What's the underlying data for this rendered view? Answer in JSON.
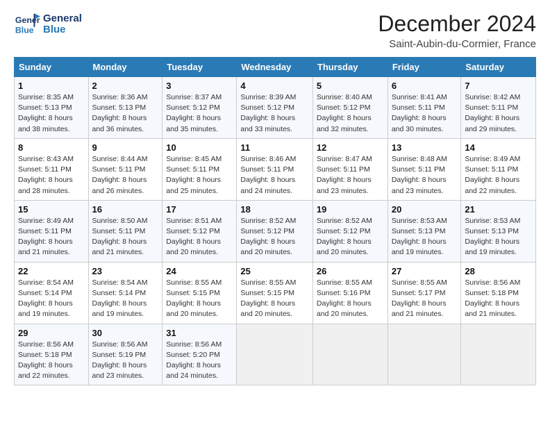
{
  "header": {
    "logo_general": "General",
    "logo_blue": "Blue",
    "month_title": "December 2024",
    "location": "Saint-Aubin-du-Cormier, France"
  },
  "days_of_week": [
    "Sunday",
    "Monday",
    "Tuesday",
    "Wednesday",
    "Thursday",
    "Friday",
    "Saturday"
  ],
  "weeks": [
    [
      {
        "day": "1",
        "info": "Sunrise: 8:35 AM\nSunset: 5:13 PM\nDaylight: 8 hours\nand 38 minutes."
      },
      {
        "day": "2",
        "info": "Sunrise: 8:36 AM\nSunset: 5:13 PM\nDaylight: 8 hours\nand 36 minutes."
      },
      {
        "day": "3",
        "info": "Sunrise: 8:37 AM\nSunset: 5:12 PM\nDaylight: 8 hours\nand 35 minutes."
      },
      {
        "day": "4",
        "info": "Sunrise: 8:39 AM\nSunset: 5:12 PM\nDaylight: 8 hours\nand 33 minutes."
      },
      {
        "day": "5",
        "info": "Sunrise: 8:40 AM\nSunset: 5:12 PM\nDaylight: 8 hours\nand 32 minutes."
      },
      {
        "day": "6",
        "info": "Sunrise: 8:41 AM\nSunset: 5:11 PM\nDaylight: 8 hours\nand 30 minutes."
      },
      {
        "day": "7",
        "info": "Sunrise: 8:42 AM\nSunset: 5:11 PM\nDaylight: 8 hours\nand 29 minutes."
      }
    ],
    [
      {
        "day": "8",
        "info": "Sunrise: 8:43 AM\nSunset: 5:11 PM\nDaylight: 8 hours\nand 28 minutes."
      },
      {
        "day": "9",
        "info": "Sunrise: 8:44 AM\nSunset: 5:11 PM\nDaylight: 8 hours\nand 26 minutes."
      },
      {
        "day": "10",
        "info": "Sunrise: 8:45 AM\nSunset: 5:11 PM\nDaylight: 8 hours\nand 25 minutes."
      },
      {
        "day": "11",
        "info": "Sunrise: 8:46 AM\nSunset: 5:11 PM\nDaylight: 8 hours\nand 24 minutes."
      },
      {
        "day": "12",
        "info": "Sunrise: 8:47 AM\nSunset: 5:11 PM\nDaylight: 8 hours\nand 23 minutes."
      },
      {
        "day": "13",
        "info": "Sunrise: 8:48 AM\nSunset: 5:11 PM\nDaylight: 8 hours\nand 23 minutes."
      },
      {
        "day": "14",
        "info": "Sunrise: 8:49 AM\nSunset: 5:11 PM\nDaylight: 8 hours\nand 22 minutes."
      }
    ],
    [
      {
        "day": "15",
        "info": "Sunrise: 8:49 AM\nSunset: 5:11 PM\nDaylight: 8 hours\nand 21 minutes."
      },
      {
        "day": "16",
        "info": "Sunrise: 8:50 AM\nSunset: 5:11 PM\nDaylight: 8 hours\nand 21 minutes."
      },
      {
        "day": "17",
        "info": "Sunrise: 8:51 AM\nSunset: 5:12 PM\nDaylight: 8 hours\nand 20 minutes."
      },
      {
        "day": "18",
        "info": "Sunrise: 8:52 AM\nSunset: 5:12 PM\nDaylight: 8 hours\nand 20 minutes."
      },
      {
        "day": "19",
        "info": "Sunrise: 8:52 AM\nSunset: 5:12 PM\nDaylight: 8 hours\nand 20 minutes."
      },
      {
        "day": "20",
        "info": "Sunrise: 8:53 AM\nSunset: 5:13 PM\nDaylight: 8 hours\nand 19 minutes."
      },
      {
        "day": "21",
        "info": "Sunrise: 8:53 AM\nSunset: 5:13 PM\nDaylight: 8 hours\nand 19 minutes."
      }
    ],
    [
      {
        "day": "22",
        "info": "Sunrise: 8:54 AM\nSunset: 5:14 PM\nDaylight: 8 hours\nand 19 minutes."
      },
      {
        "day": "23",
        "info": "Sunrise: 8:54 AM\nSunset: 5:14 PM\nDaylight: 8 hours\nand 19 minutes."
      },
      {
        "day": "24",
        "info": "Sunrise: 8:55 AM\nSunset: 5:15 PM\nDaylight: 8 hours\nand 20 minutes."
      },
      {
        "day": "25",
        "info": "Sunrise: 8:55 AM\nSunset: 5:15 PM\nDaylight: 8 hours\nand 20 minutes."
      },
      {
        "day": "26",
        "info": "Sunrise: 8:55 AM\nSunset: 5:16 PM\nDaylight: 8 hours\nand 20 minutes."
      },
      {
        "day": "27",
        "info": "Sunrise: 8:55 AM\nSunset: 5:17 PM\nDaylight: 8 hours\nand 21 minutes."
      },
      {
        "day": "28",
        "info": "Sunrise: 8:56 AM\nSunset: 5:18 PM\nDaylight: 8 hours\nand 21 minutes."
      }
    ],
    [
      {
        "day": "29",
        "info": "Sunrise: 8:56 AM\nSunset: 5:18 PM\nDaylight: 8 hours\nand 22 minutes."
      },
      {
        "day": "30",
        "info": "Sunrise: 8:56 AM\nSunset: 5:19 PM\nDaylight: 8 hours\nand 23 minutes."
      },
      {
        "day": "31",
        "info": "Sunrise: 8:56 AM\nSunset: 5:20 PM\nDaylight: 8 hours\nand 24 minutes."
      },
      {
        "day": "",
        "info": ""
      },
      {
        "day": "",
        "info": ""
      },
      {
        "day": "",
        "info": ""
      },
      {
        "day": "",
        "info": ""
      }
    ]
  ]
}
